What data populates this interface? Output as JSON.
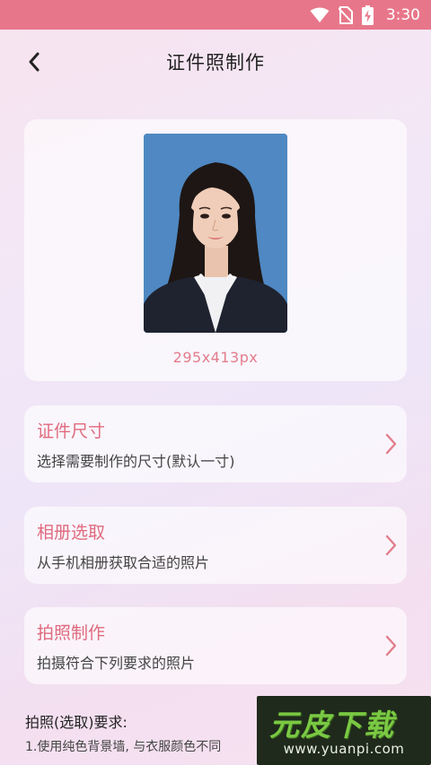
{
  "status_bar": {
    "time": "3:30",
    "icons": [
      "wifi-icon",
      "no-sim-icon",
      "battery-charging-icon"
    ],
    "background": "#e8768a"
  },
  "header": {
    "title": "证件照制作",
    "back_icon": "chevron-left-icon"
  },
  "photo_preview": {
    "size_label": "295x413px",
    "background_color": "#4f88c2"
  },
  "options": [
    {
      "title": "证件尺寸",
      "description": "选择需要制作的尺寸(默认一寸)",
      "icon": "chevron-right-icon"
    },
    {
      "title": "相册选取",
      "description": "从手机相册获取合适的照片",
      "icon": "chevron-right-icon"
    },
    {
      "title": "拍照制作",
      "description": "拍摄符合下列要求的照片",
      "icon": "chevron-right-icon"
    }
  ],
  "requirements": {
    "title": "拍照(选取)要求:",
    "items": [
      "1.使用纯色背景墙, 与衣服颜色不同"
    ]
  },
  "watermark": {
    "logo": "元皮下载",
    "url": "www.yuanpi.com"
  },
  "colors": {
    "accent": "#e06a7e",
    "arrow": "#e27d8c"
  }
}
